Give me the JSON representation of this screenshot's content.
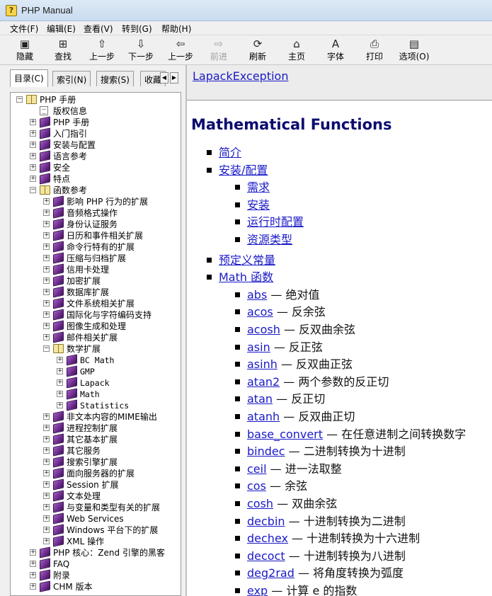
{
  "window": {
    "title": "PHP Manual"
  },
  "menu": [
    "文件(F)",
    "编辑(E)",
    "查看(V)",
    "转到(G)",
    "帮助(H)"
  ],
  "toolbar": [
    {
      "label": "隐藏",
      "icon": "hide-icon",
      "glyph": "▣",
      "enabled": true
    },
    {
      "label": "查找",
      "icon": "locate-icon",
      "glyph": "⊞",
      "enabled": true
    },
    {
      "label": "上一步",
      "icon": "up-arrow-icon",
      "glyph": "⇧",
      "enabled": true
    },
    {
      "label": "下一步",
      "icon": "down-arrow-icon",
      "glyph": "⇩",
      "enabled": true
    },
    {
      "label": "上一步",
      "icon": "back-arrow-icon",
      "glyph": "⇦",
      "enabled": true
    },
    {
      "label": "前进",
      "icon": "forward-arrow-icon",
      "glyph": "⇨",
      "enabled": false
    },
    {
      "label": "刷新",
      "icon": "refresh-icon",
      "glyph": "⟳",
      "enabled": true
    },
    {
      "label": "主页",
      "icon": "home-icon",
      "glyph": "⌂",
      "enabled": true
    },
    {
      "label": "字体",
      "icon": "font-icon",
      "glyph": "A",
      "enabled": true
    },
    {
      "label": "打印",
      "icon": "print-icon",
      "glyph": "⎙",
      "enabled": true
    },
    {
      "label": "选项(O)",
      "icon": "options-icon",
      "glyph": "▤",
      "enabled": true
    }
  ],
  "tabs": [
    "目录(C)",
    "索引(N)",
    "搜索(S)",
    "收藏"
  ],
  "tree": [
    {
      "label": "PHP 手册",
      "level": 0,
      "icon": "book-open",
      "expanded": true,
      "mono": false
    },
    {
      "label": "版权信息",
      "level": 1,
      "icon": "page",
      "expanded": null,
      "mono": false
    },
    {
      "label": "PHP 手册",
      "level": 1,
      "icon": "book",
      "expanded": false,
      "mono": false
    },
    {
      "label": "入门指引",
      "level": 1,
      "icon": "book",
      "expanded": false,
      "mono": false
    },
    {
      "label": "安装与配置",
      "level": 1,
      "icon": "book",
      "expanded": false,
      "mono": false
    },
    {
      "label": "语言参考",
      "level": 1,
      "icon": "book",
      "expanded": false,
      "mono": false
    },
    {
      "label": "安全",
      "level": 1,
      "icon": "book",
      "expanded": false,
      "mono": false
    },
    {
      "label": "特点",
      "level": 1,
      "icon": "book",
      "expanded": false,
      "mono": false
    },
    {
      "label": "函数参考",
      "level": 1,
      "icon": "book-open",
      "expanded": true,
      "mono": false
    },
    {
      "label": "影响 PHP 行为的扩展",
      "level": 2,
      "icon": "book",
      "expanded": false,
      "mono": false
    },
    {
      "label": "音频格式操作",
      "level": 2,
      "icon": "book",
      "expanded": false,
      "mono": false
    },
    {
      "label": "身份认证服务",
      "level": 2,
      "icon": "book",
      "expanded": false,
      "mono": false
    },
    {
      "label": "日历和事件相关扩展",
      "level": 2,
      "icon": "book",
      "expanded": false,
      "mono": false
    },
    {
      "label": "命令行特有的扩展",
      "level": 2,
      "icon": "book",
      "expanded": false,
      "mono": false
    },
    {
      "label": "压缩与归档扩展",
      "level": 2,
      "icon": "book",
      "expanded": false,
      "mono": false
    },
    {
      "label": "信用卡处理",
      "level": 2,
      "icon": "book",
      "expanded": false,
      "mono": false
    },
    {
      "label": "加密扩展",
      "level": 2,
      "icon": "book",
      "expanded": false,
      "mono": false
    },
    {
      "label": "数据库扩展",
      "level": 2,
      "icon": "book",
      "expanded": false,
      "mono": false
    },
    {
      "label": "文件系统相关扩展",
      "level": 2,
      "icon": "book",
      "expanded": false,
      "mono": false
    },
    {
      "label": "国际化与字符编码支持",
      "level": 2,
      "icon": "book",
      "expanded": false,
      "mono": false
    },
    {
      "label": "图像生成和处理",
      "level": 2,
      "icon": "book",
      "expanded": false,
      "mono": false
    },
    {
      "label": "邮件相关扩展",
      "level": 2,
      "icon": "book",
      "expanded": false,
      "mono": false
    },
    {
      "label": "数学扩展",
      "level": 2,
      "icon": "book-open",
      "expanded": true,
      "mono": false
    },
    {
      "label": "BC Math",
      "level": 3,
      "icon": "book",
      "expanded": false,
      "mono": true
    },
    {
      "label": "GMP",
      "level": 3,
      "icon": "book",
      "expanded": false,
      "mono": true
    },
    {
      "label": "Lapack",
      "level": 3,
      "icon": "book",
      "expanded": false,
      "mono": true
    },
    {
      "label": "Math",
      "level": 3,
      "icon": "book",
      "expanded": false,
      "mono": true
    },
    {
      "label": "Statistics",
      "level": 3,
      "icon": "book",
      "expanded": false,
      "mono": true
    },
    {
      "label": "非文本内容的MIME输出",
      "level": 2,
      "icon": "book",
      "expanded": false,
      "mono": false
    },
    {
      "label": "进程控制扩展",
      "level": 2,
      "icon": "book",
      "expanded": false,
      "mono": false
    },
    {
      "label": "其它基本扩展",
      "level": 2,
      "icon": "book",
      "expanded": false,
      "mono": false
    },
    {
      "label": "其它服务",
      "level": 2,
      "icon": "book",
      "expanded": false,
      "mono": false
    },
    {
      "label": "搜索引擎扩展",
      "level": 2,
      "icon": "book",
      "expanded": false,
      "mono": false
    },
    {
      "label": "面向服务器的扩展",
      "level": 2,
      "icon": "book",
      "expanded": false,
      "mono": false
    },
    {
      "label": "Session 扩展",
      "level": 2,
      "icon": "book",
      "expanded": false,
      "mono": false
    },
    {
      "label": "文本处理",
      "level": 2,
      "icon": "book",
      "expanded": false,
      "mono": false
    },
    {
      "label": "与变量和类型有关的扩展",
      "level": 2,
      "icon": "book",
      "expanded": false,
      "mono": false
    },
    {
      "label": "Web Services",
      "level": 2,
      "icon": "book",
      "expanded": false,
      "mono": false
    },
    {
      "label": "Windows 平台下的扩展",
      "level": 2,
      "icon": "book",
      "expanded": false,
      "mono": false
    },
    {
      "label": "XML 操作",
      "level": 2,
      "icon": "book",
      "expanded": false,
      "mono": false
    },
    {
      "label": "PHP 核心：Zend 引擎的黑客",
      "level": 1,
      "icon": "book",
      "expanded": false,
      "mono": false
    },
    {
      "label": "FAQ",
      "level": 1,
      "icon": "book",
      "expanded": false,
      "mono": false
    },
    {
      "label": "附录",
      "level": 1,
      "icon": "book",
      "expanded": false,
      "mono": false
    },
    {
      "label": "CHM 版本",
      "level": 1,
      "icon": "book",
      "expanded": false,
      "mono": false
    }
  ],
  "content": {
    "nav_link": "LapackException",
    "heading": "Mathematical Functions",
    "items": [
      {
        "level": 0,
        "link": "简介",
        "desc": ""
      },
      {
        "level": 0,
        "link": "安装/配置",
        "desc": ""
      },
      {
        "level": 1,
        "link": "需求",
        "desc": ""
      },
      {
        "level": 1,
        "link": "安装",
        "desc": ""
      },
      {
        "level": 1,
        "link": "运行时配置",
        "desc": ""
      },
      {
        "level": 1,
        "link": "资源类型",
        "desc": ""
      },
      {
        "level": 0,
        "link": "预定义常量",
        "desc": ""
      },
      {
        "level": 0,
        "link": "Math 函数",
        "desc": ""
      },
      {
        "level": 1,
        "link": "abs",
        "desc": " — 绝对值"
      },
      {
        "level": 1,
        "link": "acos",
        "desc": " — 反余弦"
      },
      {
        "level": 1,
        "link": "acosh",
        "desc": " — 反双曲余弦"
      },
      {
        "level": 1,
        "link": "asin",
        "desc": " — 反正弦"
      },
      {
        "level": 1,
        "link": "asinh",
        "desc": " — 反双曲正弦"
      },
      {
        "level": 1,
        "link": "atan2",
        "desc": " — 两个参数的反正切"
      },
      {
        "level": 1,
        "link": "atan",
        "desc": " — 反正切"
      },
      {
        "level": 1,
        "link": "atanh",
        "desc": " — 反双曲正切"
      },
      {
        "level": 1,
        "link": "base_convert",
        "desc": " — 在任意进制之间转换数字"
      },
      {
        "level": 1,
        "link": "bindec",
        "desc": " — 二进制转换为十进制"
      },
      {
        "level": 1,
        "link": "ceil",
        "desc": " — 进一法取整"
      },
      {
        "level": 1,
        "link": "cos",
        "desc": " — 余弦"
      },
      {
        "level": 1,
        "link": "cosh",
        "desc": " — 双曲余弦"
      },
      {
        "level": 1,
        "link": "decbin",
        "desc": " — 十进制转换为二进制"
      },
      {
        "level": 1,
        "link": "dechex",
        "desc": " — 十进制转换为十六进制"
      },
      {
        "level": 1,
        "link": "decoct",
        "desc": " — 十进制转换为八进制"
      },
      {
        "level": 1,
        "link": "deg2rad",
        "desc": " — 将角度转换为弧度"
      },
      {
        "level": 1,
        "link": "exp",
        "desc": " — 计算 e 的指数"
      }
    ]
  }
}
